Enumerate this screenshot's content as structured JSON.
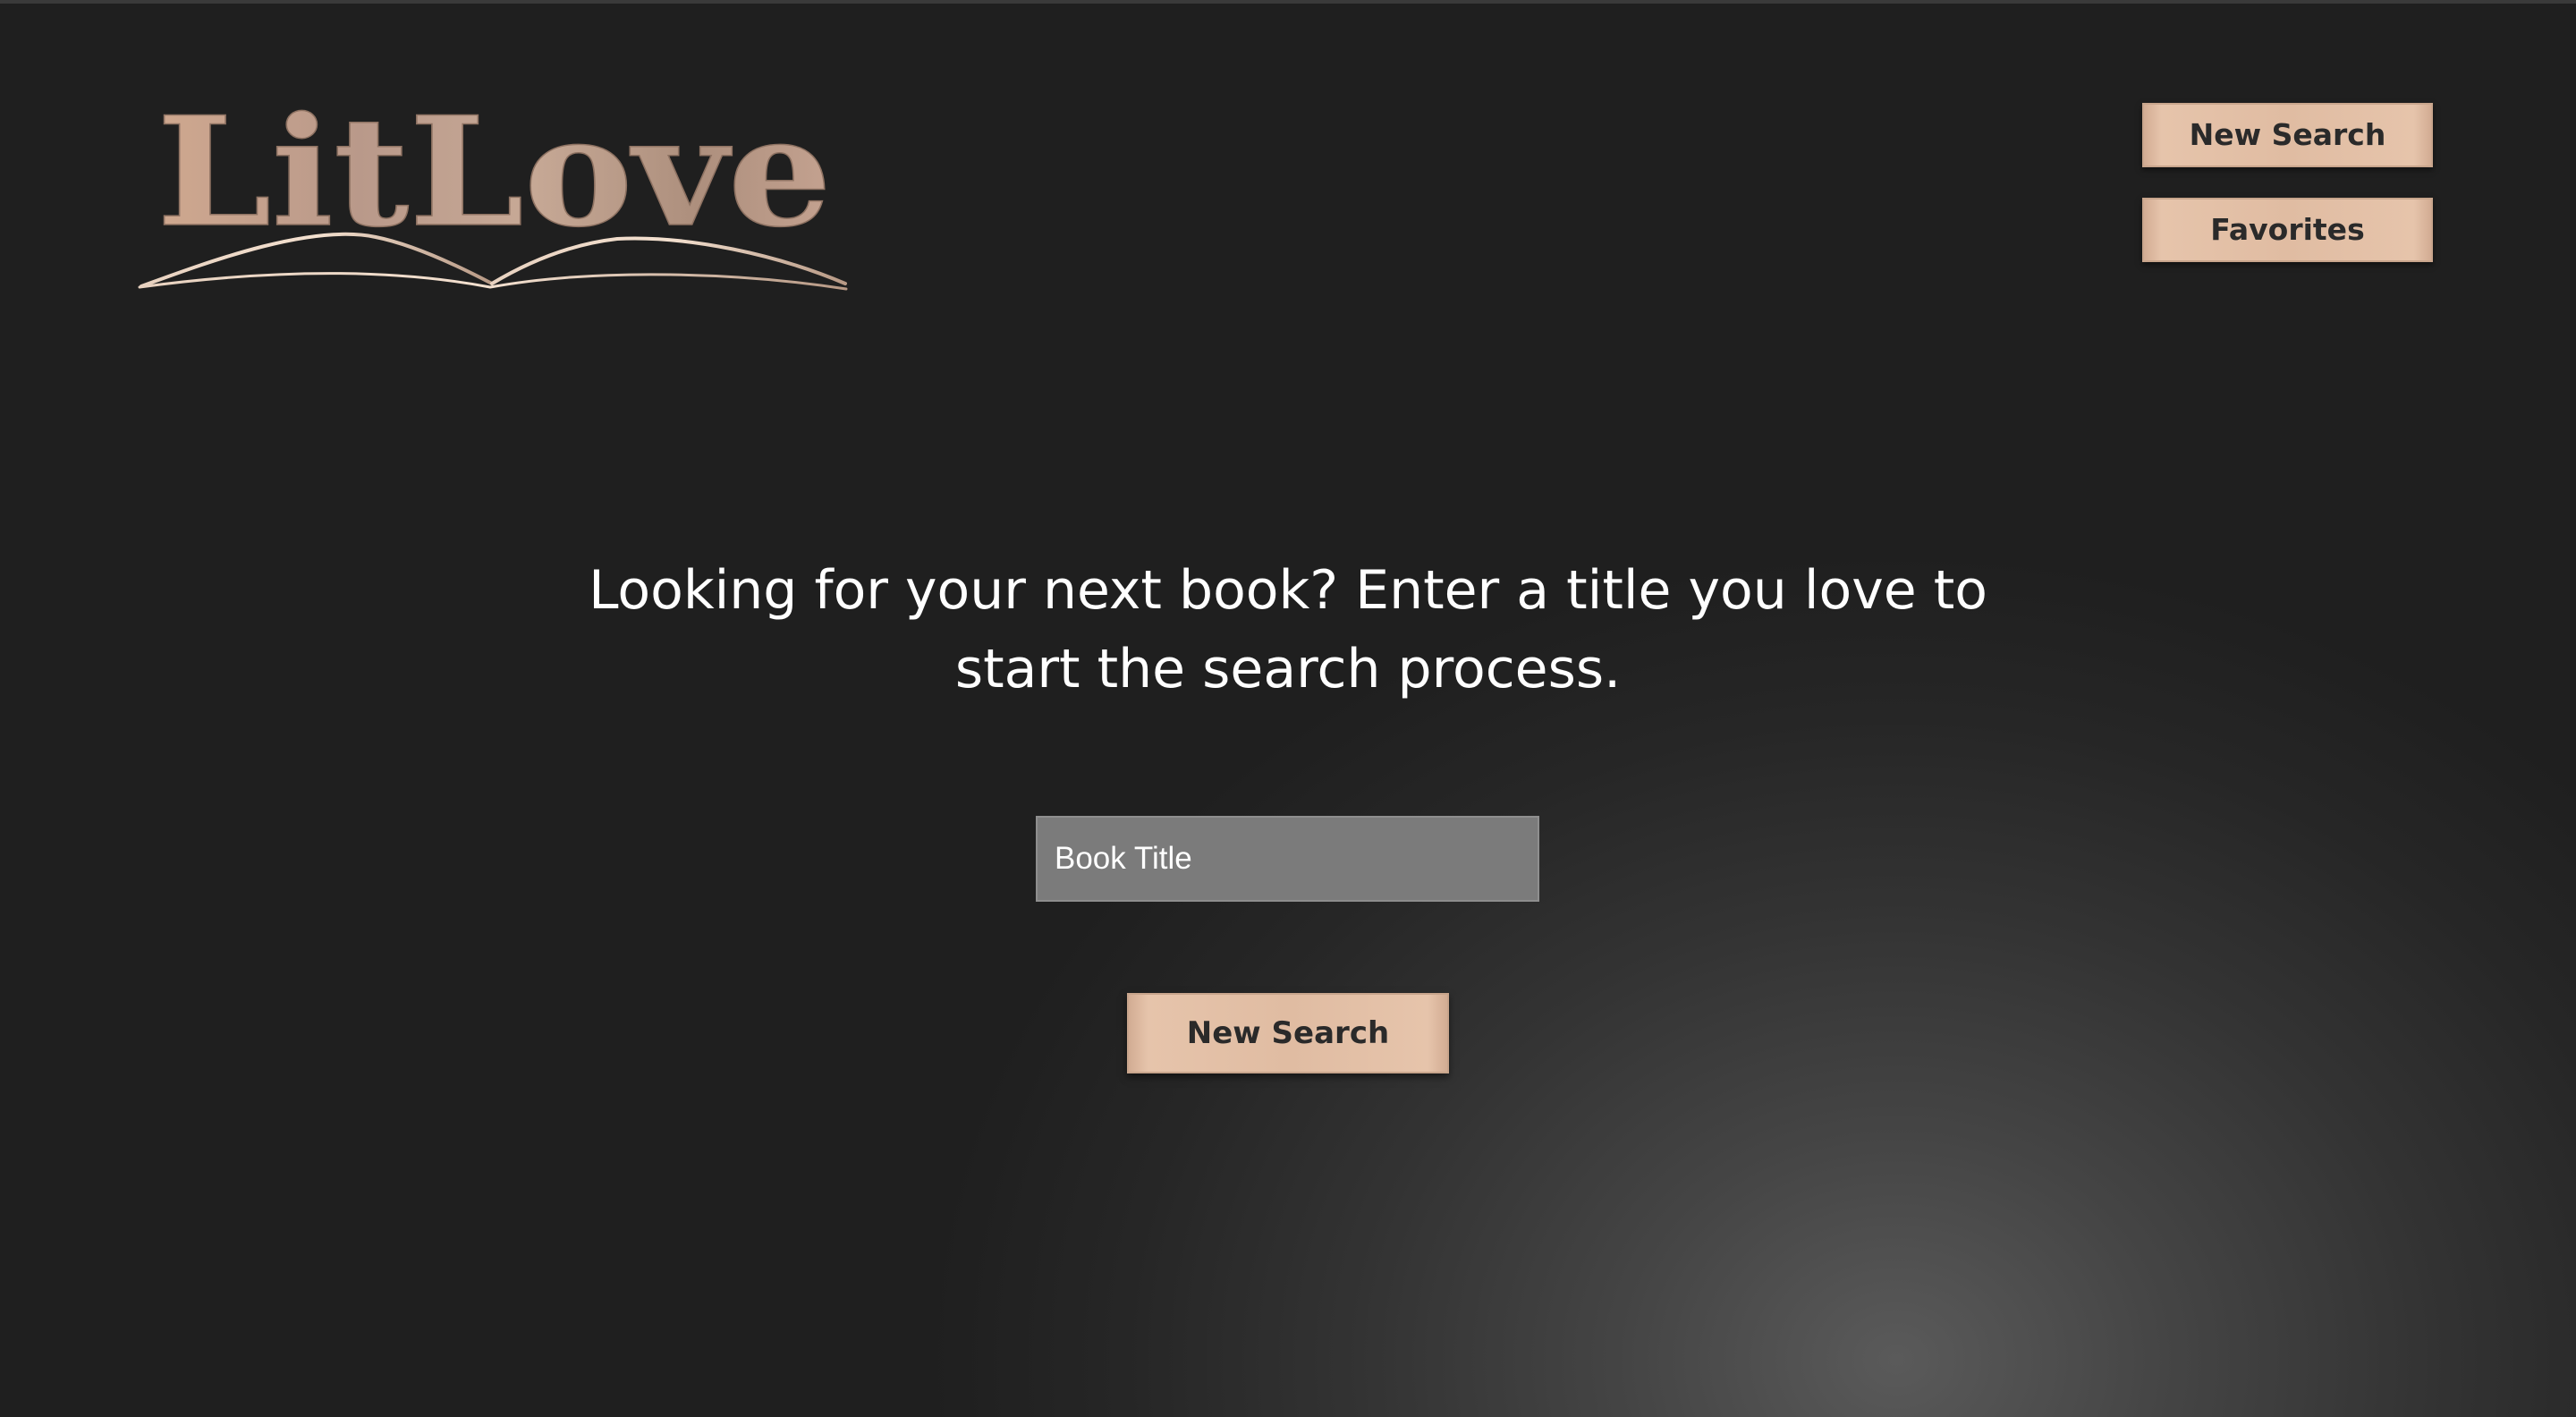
{
  "app": {
    "logo_text": "LitLove"
  },
  "nav": {
    "new_search_label": "New Search",
    "favorites_label": "Favorites"
  },
  "main": {
    "intro_text": "Looking for your next book? Enter a title you love to start the search process.",
    "search_input": {
      "placeholder": "Book Title",
      "value": ""
    },
    "search_button_label": "New Search"
  },
  "icons": {
    "logo_book": "open-book-icon"
  },
  "colors": {
    "background": "#1f1f1f",
    "accent": "#e0bca2",
    "logo_gradient_start": "#cfa88f",
    "logo_gradient_end": "#a88a78",
    "input_background": "#7b7b7b",
    "button_text": "#2a2a2a",
    "text": "#ffffff"
  }
}
